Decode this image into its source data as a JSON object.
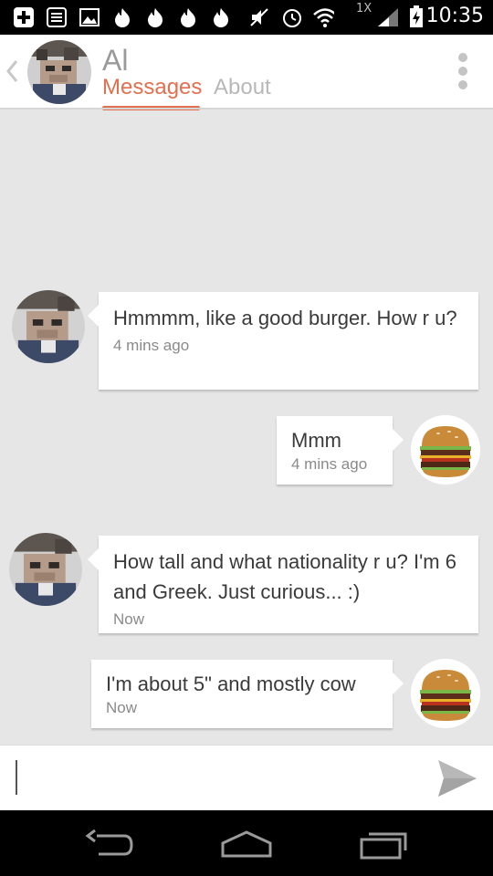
{
  "status_bar": {
    "time": "10:35",
    "network_badge": "1X",
    "icons": [
      "plus-box-icon",
      "list-box-icon",
      "image-icon",
      "flame-icon",
      "flame-icon",
      "flame-icon",
      "flame-icon",
      "mute-icon",
      "alarm-icon",
      "wifi-icon",
      "signal-icon",
      "battery-charging-icon"
    ]
  },
  "header": {
    "contact_name": "Al",
    "tabs": [
      {
        "label": "Messages",
        "active": true
      },
      {
        "label": "About",
        "active": false
      }
    ],
    "accent_color": "#e07050"
  },
  "messages": [
    {
      "sender": "them",
      "text": "Hmmmm, like a good burger. How r u?",
      "time": "4 mins ago"
    },
    {
      "sender": "me",
      "text": "Mmm",
      "time": "4 mins ago"
    },
    {
      "sender": "them",
      "text": "How tall and what nationality r u? I'm 6 and Greek. Just curious... :)",
      "time": "Now"
    },
    {
      "sender": "me",
      "text": "I'm about 5\" and mostly cow",
      "time": "Now"
    }
  ],
  "composer": {
    "placeholder": "",
    "value": ""
  },
  "nav_bar": {
    "buttons": [
      "back-icon",
      "home-icon",
      "recents-icon"
    ]
  }
}
